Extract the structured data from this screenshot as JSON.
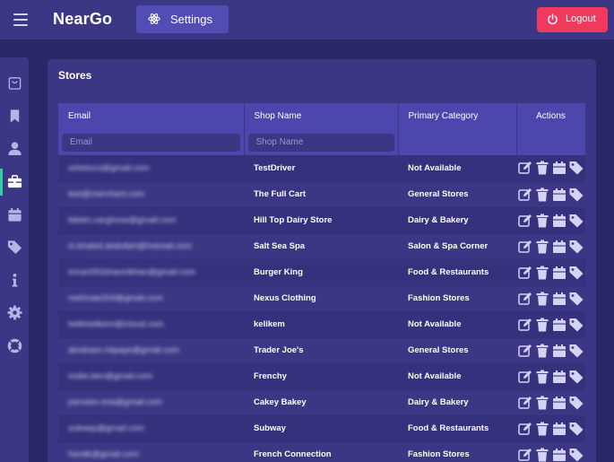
{
  "header": {
    "brand": "NearGo",
    "settings_label": "Settings",
    "logout_label": "Logout"
  },
  "sidebar": {
    "items": [
      {
        "icon": "shopping-bag-icon"
      },
      {
        "icon": "bookmark-icon"
      },
      {
        "icon": "user-icon"
      },
      {
        "icon": "briefcase-icon",
        "active": true
      },
      {
        "icon": "calendar-icon"
      },
      {
        "icon": "tag-icon"
      },
      {
        "icon": "info-icon"
      },
      {
        "icon": "gear-icon"
      },
      {
        "icon": "lifebuoy-icon"
      }
    ]
  },
  "stores": {
    "title": "Stores",
    "columns": [
      "Email",
      "Shop Name",
      "Primary Category",
      "Actions"
    ],
    "filters": {
      "email_placeholder": "Email",
      "shop_placeholder": "Shop Name"
    },
    "rows": [
      {
        "email": "sshetucs@gmail.com",
        "shop": "TestDriver",
        "category": "Not Available"
      },
      {
        "email": "test@merchant.com",
        "shop": "The Full Cart",
        "category": "General Stores"
      },
      {
        "email": "fabien.carghose@gmail.com",
        "shop": "Hill Top Dairy Store",
        "category": "Dairy & Bakery"
      },
      {
        "email": "m.khaled.abdullah@hotmail.com",
        "shop": "Salt Sea Spa",
        "category": "Salon & Spa Corner"
      },
      {
        "email": "imran091bhamrikhan@gmail.com",
        "shop": "Burger King",
        "category": "Food & Restaurants"
      },
      {
        "email": "mehmae204@gmail.com",
        "shop": "Nexus Clothing",
        "category": "Fashion Stores"
      },
      {
        "email": "kelkinelikem@icloud.com",
        "shop": "kelikem",
        "category": "Not Available"
      },
      {
        "email": "abraham.mtpaye@gmail.com",
        "shop": "Trader Joe's",
        "category": "General Stores"
      },
      {
        "email": "iosbe.ben@gmail.com",
        "shop": "Frenchy",
        "category": "Not Available"
      },
      {
        "email": "parveen.ima@gmail.com",
        "shop": "Cakey Bakey",
        "category": "Dairy & Bakery"
      },
      {
        "email": "subway@gmail.com",
        "shop": "Subway",
        "category": "Food & Restaurants"
      },
      {
        "email": "handk@gmail.com",
        "shop": "French Connection",
        "category": "Fashion Stores"
      }
    ],
    "row_actions": [
      "edit-icon",
      "delete-icon",
      "calendar-icon",
      "tag-icon"
    ]
  },
  "colors": {
    "background": "#2a2766",
    "panel": "#3b3784",
    "header_cell": "#4d47ad",
    "logout": "#ef3a5d",
    "active_indicator": "#2fd1a4"
  }
}
